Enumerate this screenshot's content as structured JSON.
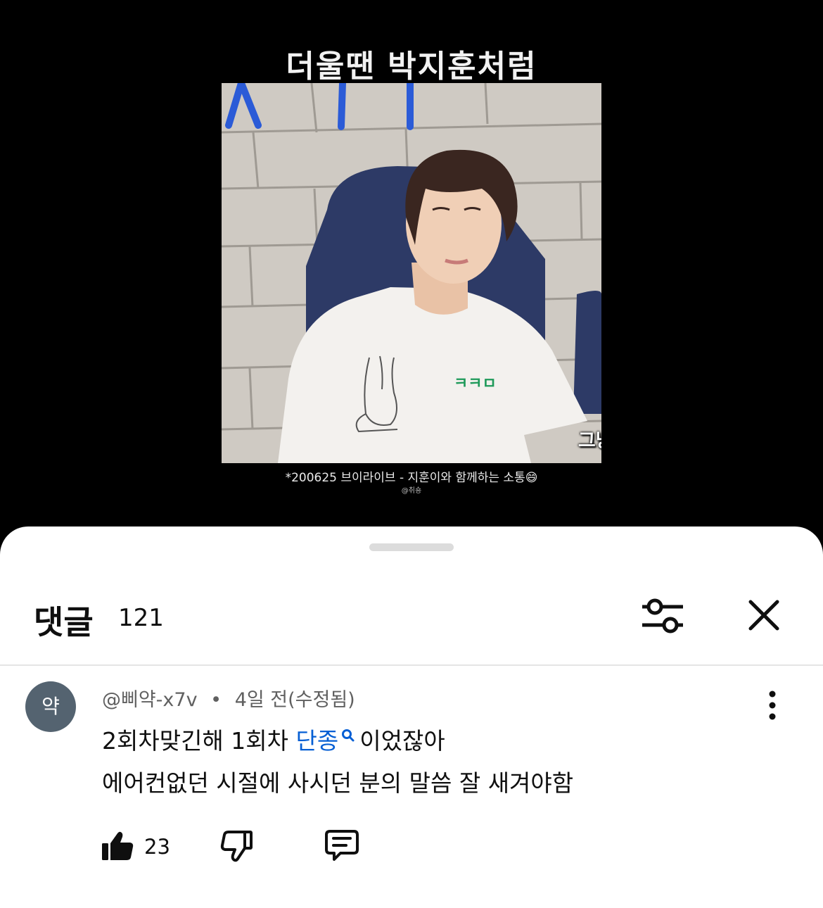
{
  "video": {
    "title": "더울땐 박지훈처럼",
    "subtitle": "그냥 가만~히",
    "caption": "*200625 브이라이브 - 지훈이와 함께하는 소통😄",
    "credit": "@취숑",
    "shirt_logo_color": "#1f9a5a",
    "wall_letters_color": "#2b5bd7"
  },
  "sheet": {
    "title": "댓글",
    "count": "121",
    "filter_icon": "sliders-icon",
    "close_icon": "close-icon"
  },
  "comment": {
    "avatar_letter": "약",
    "avatar_color": "#546370",
    "author": "@삐약-x7v",
    "separator": "•",
    "time": "4일 전(수정됨)",
    "line1_before": "2회차맞긴해 1회차 ",
    "line1_link": "단종",
    "line1_after": "이었잖아",
    "line2": "에어컨없던 시절에 사시던 분의 말씀 잘 새겨야함",
    "link_color": "#065fd4",
    "like_count": "23"
  }
}
